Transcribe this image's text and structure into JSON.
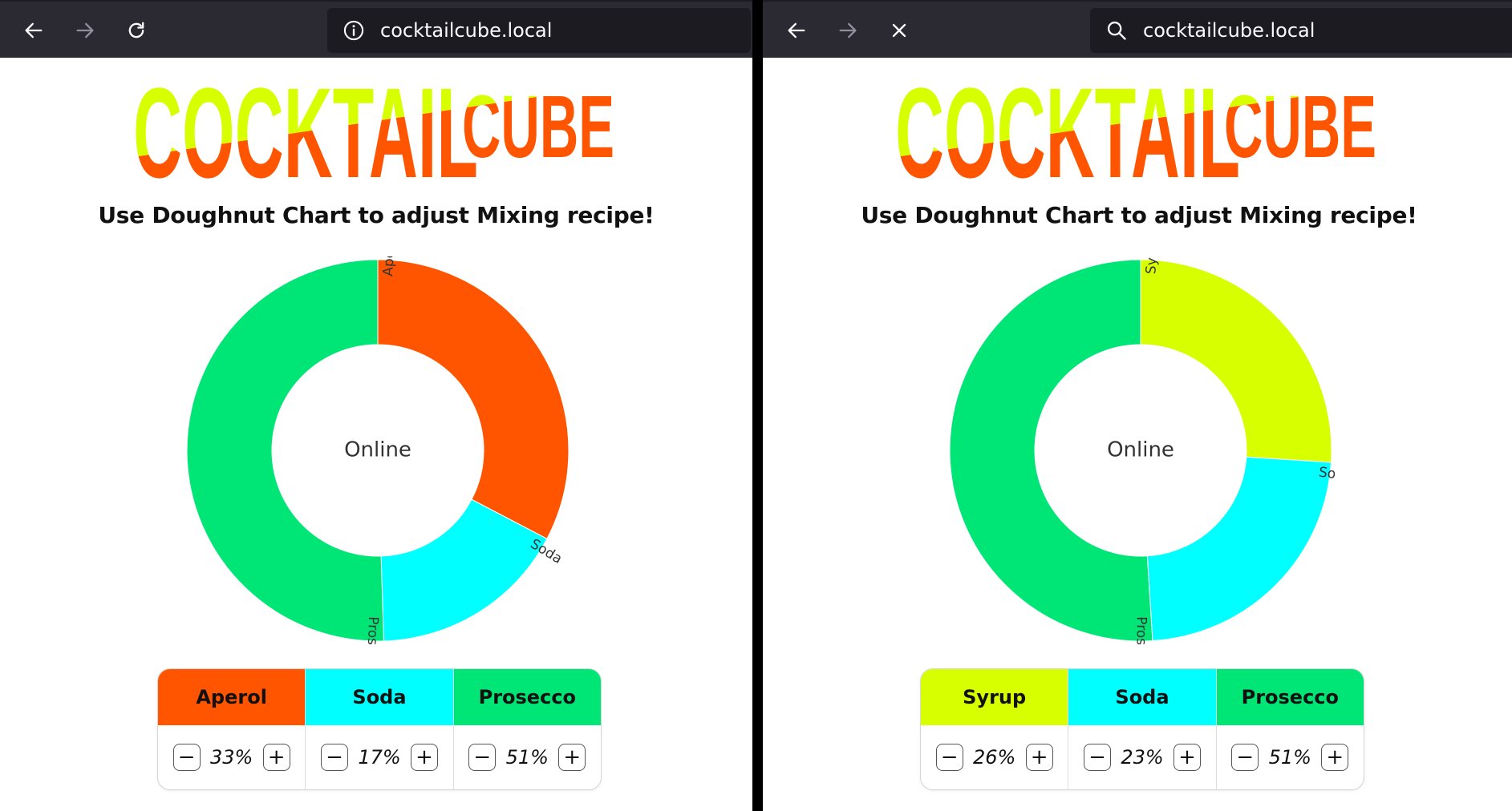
{
  "colors": {
    "aperol": "#ff5500",
    "soda": "#00ffff",
    "prosecco": "#00e676",
    "syrup": "#d7ff00",
    "toolbar": "#2b2a33",
    "urlbar": "#1c1b22"
  },
  "left": {
    "toolbar": {
      "back_icon": "arrow-left-icon",
      "forward_icon": "arrow-right-icon",
      "reload_icon": "reload-icon",
      "site_icon": "info-icon",
      "url": "cocktailcube.local"
    },
    "logo": {
      "main": "COCKTAIL",
      "sub": "CUBE"
    },
    "headline": "Use Doughnut Chart to adjust Mixing recipe!",
    "chart_data": {
      "type": "pie",
      "center_label": "Online",
      "labels": [
        "Aperol",
        "Soda",
        "Prosecco"
      ],
      "values": [
        33,
        17,
        51
      ],
      "colors": [
        "#ff5500",
        "#00ffff",
        "#00e676"
      ]
    },
    "mixer": [
      {
        "name": "Aperol",
        "value": "33%",
        "color": "#ff5500"
      },
      {
        "name": "Soda",
        "value": "17%",
        "color": "#00ffff"
      },
      {
        "name": "Prosecco",
        "value": "51%",
        "color": "#00e676"
      }
    ]
  },
  "right": {
    "toolbar": {
      "back_icon": "arrow-left-icon",
      "forward_icon": "arrow-right-icon",
      "stop_icon": "close-icon",
      "site_icon": "search-icon",
      "url": "cocktailcube.local"
    },
    "logo": {
      "main": "COCKTAIL",
      "sub": "CUBE"
    },
    "headline": "Use Doughnut Chart to adjust Mixing recipe!",
    "chart_data": {
      "type": "pie",
      "center_label": "Online",
      "labels": [
        "Syrup",
        "Soda",
        "Prosecco"
      ],
      "values": [
        26,
        23,
        51
      ],
      "colors": [
        "#d7ff00",
        "#00ffff",
        "#00e676"
      ]
    },
    "mixer": [
      {
        "name": "Syrup",
        "value": "26%",
        "color": "#d7ff00"
      },
      {
        "name": "Soda",
        "value": "23%",
        "color": "#00ffff"
      },
      {
        "name": "Prosecco",
        "value": "51%",
        "color": "#00e676"
      }
    ]
  },
  "stepper": {
    "minus": "−",
    "plus": "+"
  }
}
